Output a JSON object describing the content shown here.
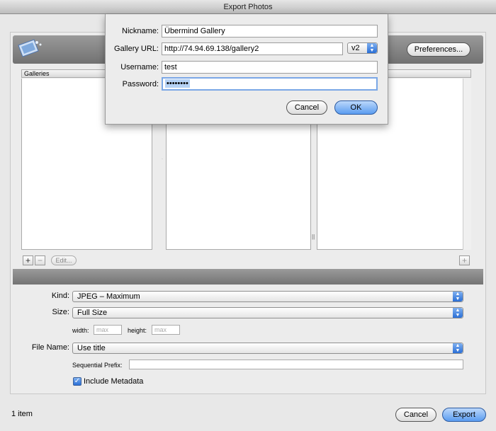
{
  "window": {
    "title": "Export Photos"
  },
  "toolbar": {
    "preferences_label": "Preferences..."
  },
  "galleries": {
    "column_header": "Galleries",
    "add_label": "+",
    "remove_label": "−",
    "edit_label": "Edit..."
  },
  "album_panel": {
    "add_label": "+"
  },
  "export_options": {
    "kind_label": "Kind:",
    "kind_value": "JPEG – Maximum",
    "size_label": "Size:",
    "size_value": "Full Size",
    "width_label": "width:",
    "width_placeholder": "max",
    "height_label": "height:",
    "height_placeholder": "max",
    "file_name_label": "File Name:",
    "file_name_value": "Use title",
    "sequential_prefix_label": "Sequential Prefix:",
    "sequential_prefix_value": "",
    "include_metadata_label": "Include Metadata",
    "include_metadata_checked": true
  },
  "footer": {
    "item_count": "1 item",
    "cancel_label": "Cancel",
    "export_label": "Export"
  },
  "sheet": {
    "nickname_label": "Nickname:",
    "nickname_value": "Übermind Gallery",
    "gallery_url_label": "Gallery URL:",
    "gallery_url_value": "http://74.94.69.138/gallery2",
    "version_value": "v2",
    "username_label": "Username:",
    "username_value": "test",
    "password_label": "Password:",
    "password_value": "••••••••",
    "cancel_label": "Cancel",
    "ok_label": "OK"
  },
  "colors": {
    "accent": "#2a6fd6",
    "focus_ring": "#7aa7e6",
    "dark_bar": "#808080"
  }
}
